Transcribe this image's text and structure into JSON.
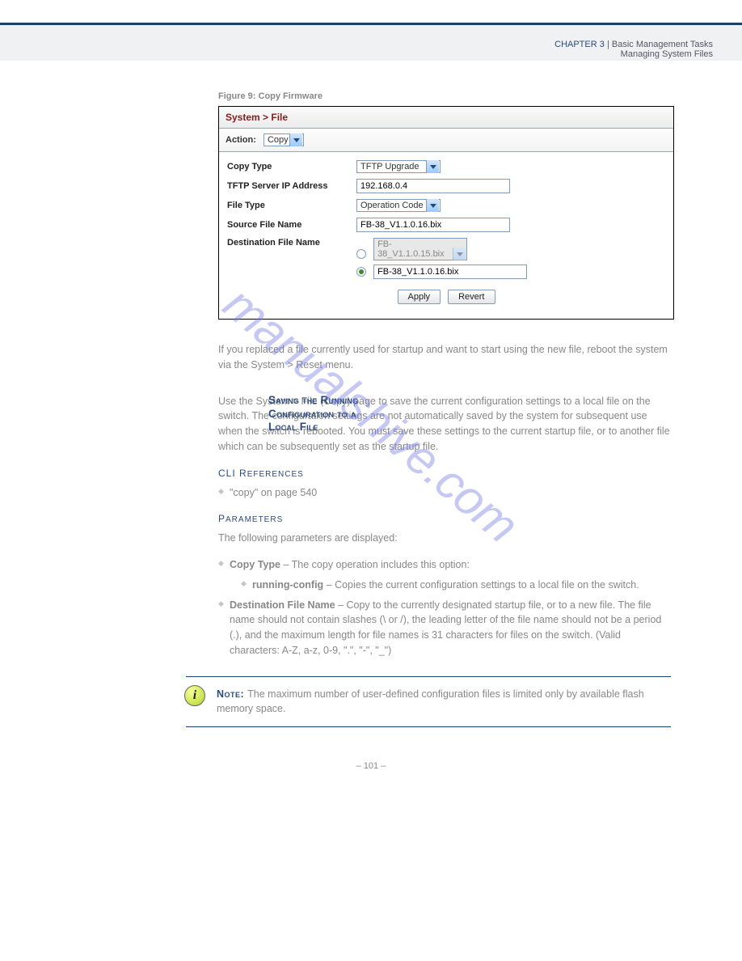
{
  "header": {
    "chapter_prefix_left": "C",
    "chapter_word_left": "HAPTER",
    "chapter_num": "3",
    "divider": " | ",
    "chapter_title": "Basic Management Tasks",
    "subtitle": "Managing System Files"
  },
  "figure": {
    "caption": "Figure 9: Copy Firmware",
    "panel_title": "System > File",
    "action_label": "Action:",
    "action_value": "Copy",
    "rows": {
      "copy_type_label": "Copy Type",
      "copy_type_value": "TFTP Upgrade",
      "tftp_label": "TFTP Server IP Address",
      "tftp_value": "192.168.0.4",
      "file_type_label": "File Type",
      "file_type_value": "Operation Code",
      "src_label": "Source File Name",
      "src_value": "FB-38_V1.1.0.16.bix",
      "dest_label": "Destination File Name",
      "dest_option_disabled": "FB-38_V1.1.0.15.bix",
      "dest_option_selected": "FB-38_V1.1.0.16.bix"
    },
    "buttons": {
      "apply": "Apply",
      "revert": "Revert"
    }
  },
  "body": {
    "para1": "If you replaced a file currently used for startup and want to start using the new file, reboot the system via the System > Reset menu.",
    "side_label": "Saving the Running Configuration to a Local File",
    "para2_lead": "Use the System > File (Copy) page to save the current configuration settings to a local file on the switch. The configuration settings are not automatically saved by the system for subsequent use when the switch is rebooted. You must save these settings to the current startup file, or to another file which can be subsequently set as the startup file.",
    "cli_head": "CLI R",
    "cli_head2": "EFERENCES",
    "cli_item": "\"copy\" on page 540",
    "param_head": "P",
    "param_head2": "ARAMETERS",
    "param_intro": "The following parameters are displayed:",
    "param1_lead": "Copy Type",
    "param1_rest": " – The copy operation includes this option:",
    "param1_sub_lead": "running-config",
    "param1_sub_rest": " – Copies the current configuration settings to a local file on the switch.",
    "param2_lead": "Destination File Name",
    "param2_rest": " – Copy to the currently designated startup file, or to a new file. The file name should not contain slashes (\\ or /), the leading letter of the file name should not be a period (.), and the maximum length for file names is 31 characters for files on the switch. (Valid characters: A-Z, a-z, 0-9, \".\", \"-\", \"_\")"
  },
  "note": {
    "label": "Note: ",
    "text": "The maximum number of user-defined configuration files is limited only by available flash memory space."
  },
  "page_number": "– 101 –",
  "watermark": "manualshive.com"
}
